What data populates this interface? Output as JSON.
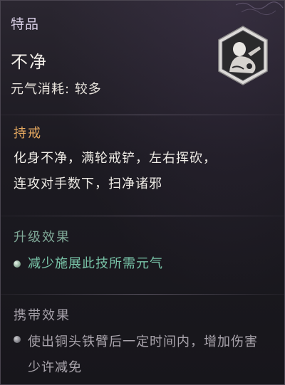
{
  "skill": {
    "rarity": "特品",
    "name": "不净",
    "cost_label": "元气消耗",
    "cost_separator": ":",
    "cost_value": "较多",
    "emblem_icon": "monk-portrait-icon"
  },
  "stance": {
    "title": "持戒",
    "description_line1": "化身不净，满轮戒铲，左右挥砍，",
    "description_line2": "连攻对手数下，扫净诸邪"
  },
  "upgrade": {
    "title": "升级效果",
    "effect": "减少施展此技所需元气"
  },
  "carry": {
    "title": "携带效果",
    "effect": "使出铜头铁臂后一定时间内，增加伤害少许减免"
  },
  "colors": {
    "rarity_text": "#d9cfe6",
    "stance_title": "#e5a860",
    "upgrade_title": "#7fa897",
    "upgrade_text": "#79c4a8",
    "carry_text": "#aaa5ad"
  }
}
